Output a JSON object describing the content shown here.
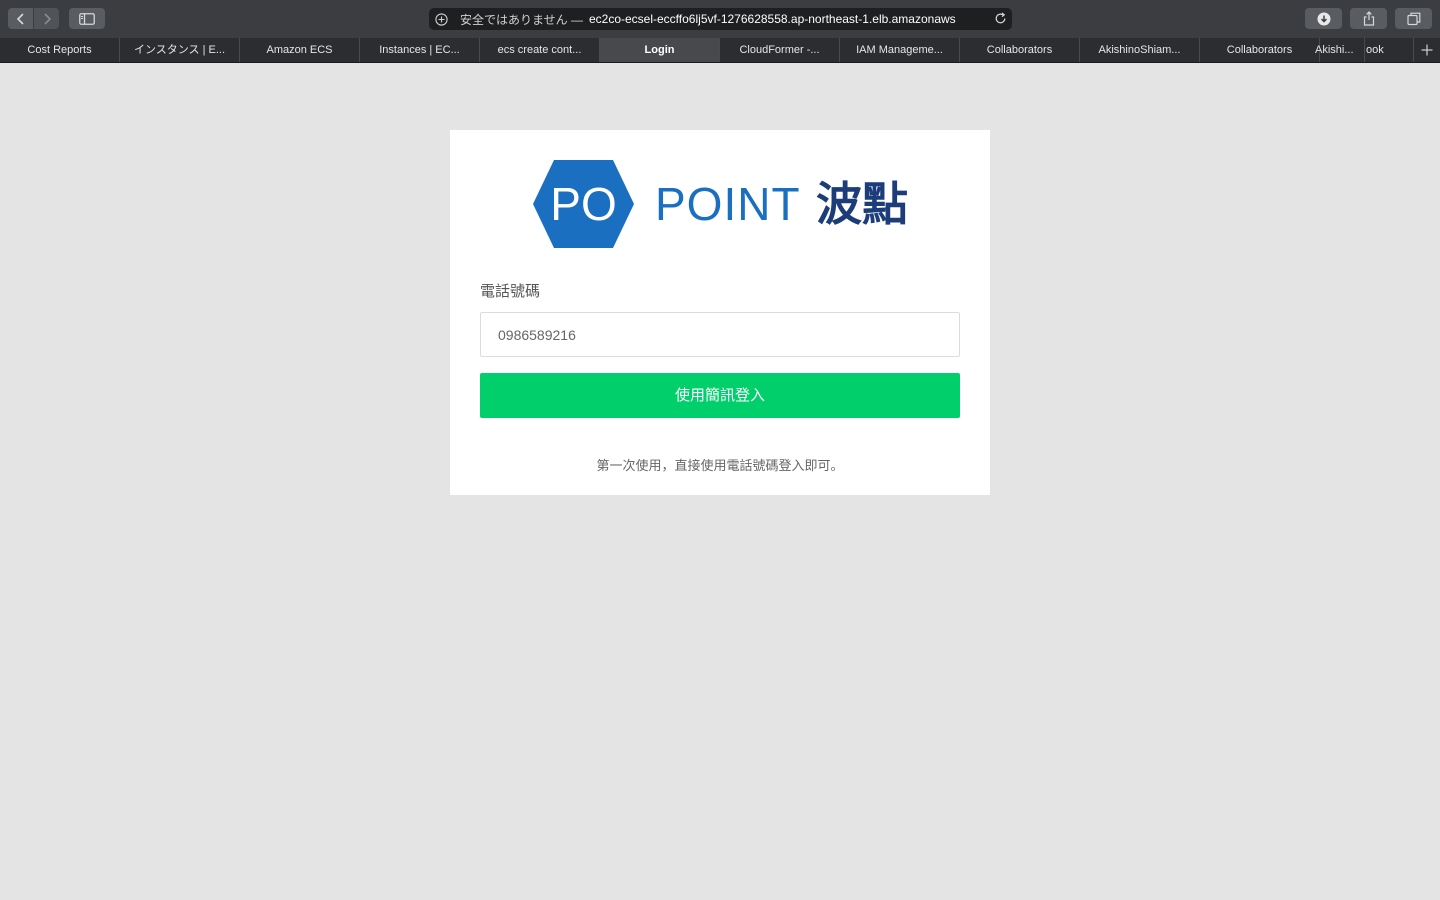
{
  "browser": {
    "address_bar": {
      "security_text": "安全ではありません —",
      "url": "ec2co-ecsel-eccffo6lj5vf-1276628558.ap-northeast-1.elb.amazonaws"
    },
    "tabs": [
      {
        "label": "Cost Reports"
      },
      {
        "label": "インスタンス | E..."
      },
      {
        "label": "Amazon ECS"
      },
      {
        "label": "Instances | EC..."
      },
      {
        "label": "ecs create cont..."
      },
      {
        "label": "Login"
      },
      {
        "label": "CloudFormer -..."
      },
      {
        "label": "IAM Manageme..."
      },
      {
        "label": "Collaborators"
      },
      {
        "label": "AkishinoShiam..."
      },
      {
        "label": "Collaborators"
      },
      {
        "label": "Akishi..."
      },
      {
        "label": "ook"
      }
    ],
    "active_tab_index": 5
  },
  "login": {
    "logo": {
      "mark_text": "PO",
      "brand_text": "POINT",
      "brand_cjk": "波點",
      "mark_color": "#1a6fc0",
      "brand_color": "#1a6fc0",
      "brand_cjk_color": "#1c3d7a"
    },
    "phone_label": "電話號碼",
    "phone_value": "0986589216",
    "submit_label": "使用簡訊登入",
    "submit_color": "#00cf6c",
    "hint": "第一次使用，直接使用電話號碼登入即可。"
  }
}
